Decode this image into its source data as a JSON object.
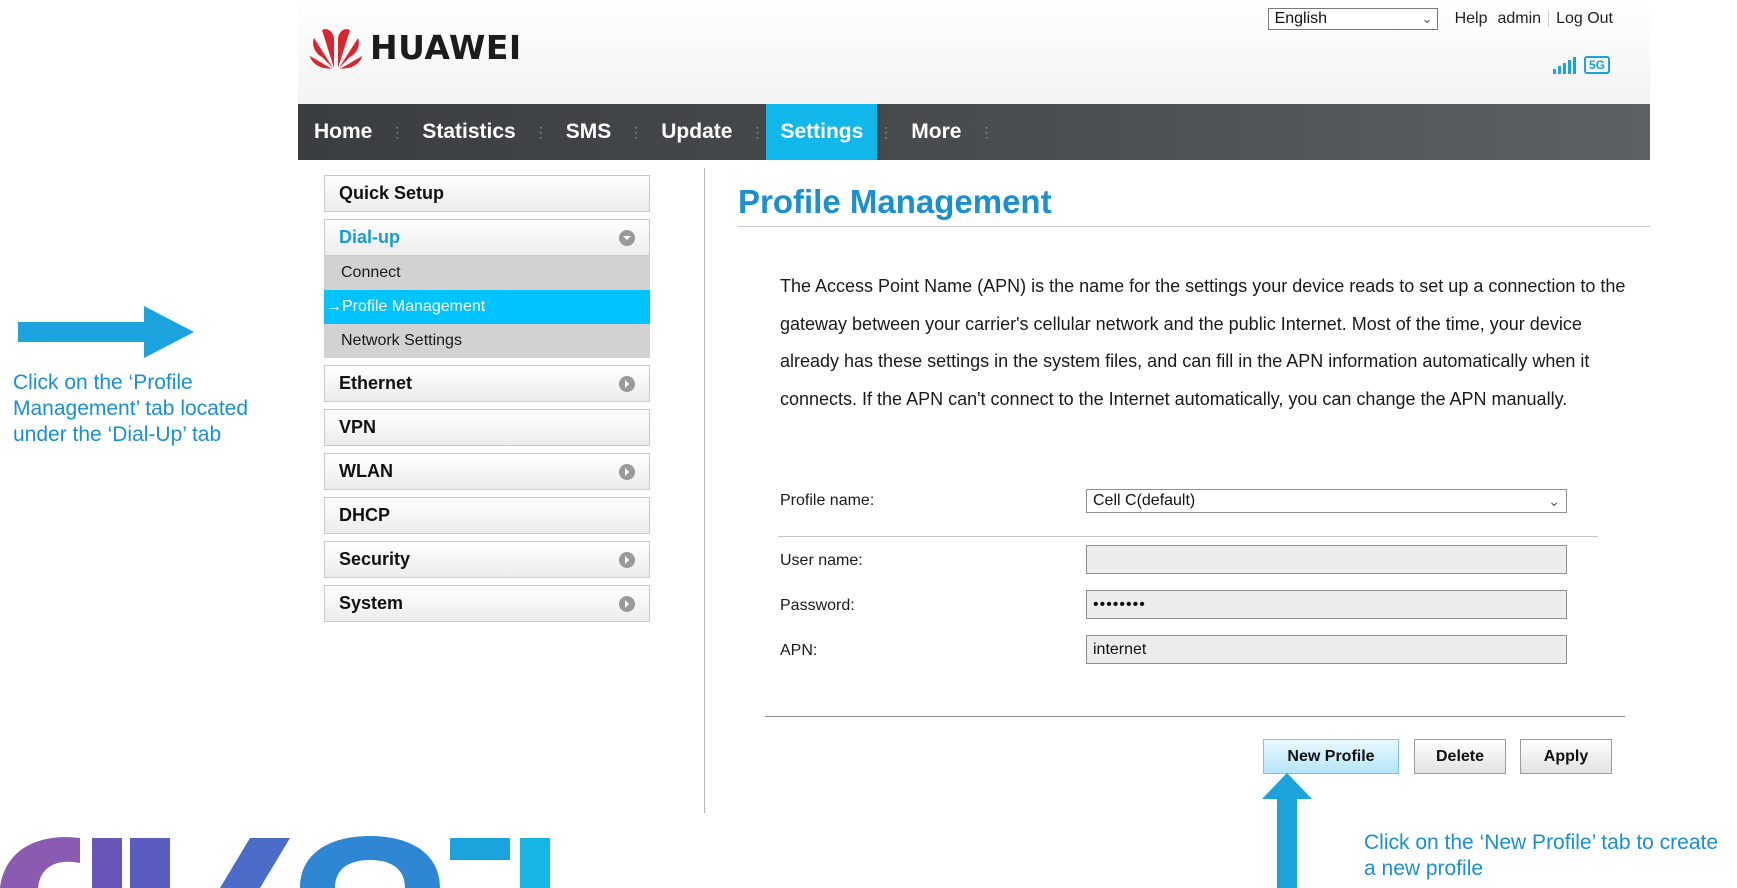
{
  "header": {
    "brand": "HUAWEI",
    "language": "English",
    "links": [
      "Help",
      "admin",
      "Log Out"
    ],
    "network_badge": "5G"
  },
  "nav": {
    "items": [
      {
        "label": "Home",
        "active": false
      },
      {
        "label": "Statistics",
        "active": false
      },
      {
        "label": "SMS",
        "active": false
      },
      {
        "label": "Update",
        "active": false
      },
      {
        "label": "Settings",
        "active": true
      },
      {
        "label": "More",
        "active": false
      }
    ]
  },
  "sidebar": {
    "quick_setup": "Quick Setup",
    "dialup": "Dial-up",
    "dialup_sub": [
      "Connect",
      "Profile Management",
      "Network Settings"
    ],
    "ethernet": "Ethernet",
    "vpn": "VPN",
    "wlan": "WLAN",
    "dhcp": "DHCP",
    "security": "Security",
    "system": "System"
  },
  "main": {
    "title": "Profile Management",
    "description": "The Access Point Name (APN) is the name for the settings your device reads to set up a connection to the gateway between your carrier's cellular network and the public Internet. Most of the time, your device already has these settings in the system files, and can fill in the APN information automatically when it connects. If the APN can't connect to the Internet automatically, you can change the APN manually.",
    "form": {
      "profile_label": "Profile name:",
      "profile_value": "Cell C(default)",
      "username_label": "User name:",
      "username_value": "",
      "password_label": "Password:",
      "password_value": "••••••••",
      "apn_label": "APN:",
      "apn_value": "internet"
    },
    "buttons": {
      "new_profile": "New Profile",
      "delete": "Delete",
      "apply": "Apply"
    }
  },
  "annotations": {
    "left_note": "Click on the ‘Profile Management’ tab located under the ‘Dial-Up’ tab",
    "bottom_note": "Click on the ‘New Profile’ tab to create a new profile"
  },
  "colors": {
    "accent": "#12b7ec",
    "title": "#1a8fd1",
    "annotation": "#1aa3dc"
  }
}
